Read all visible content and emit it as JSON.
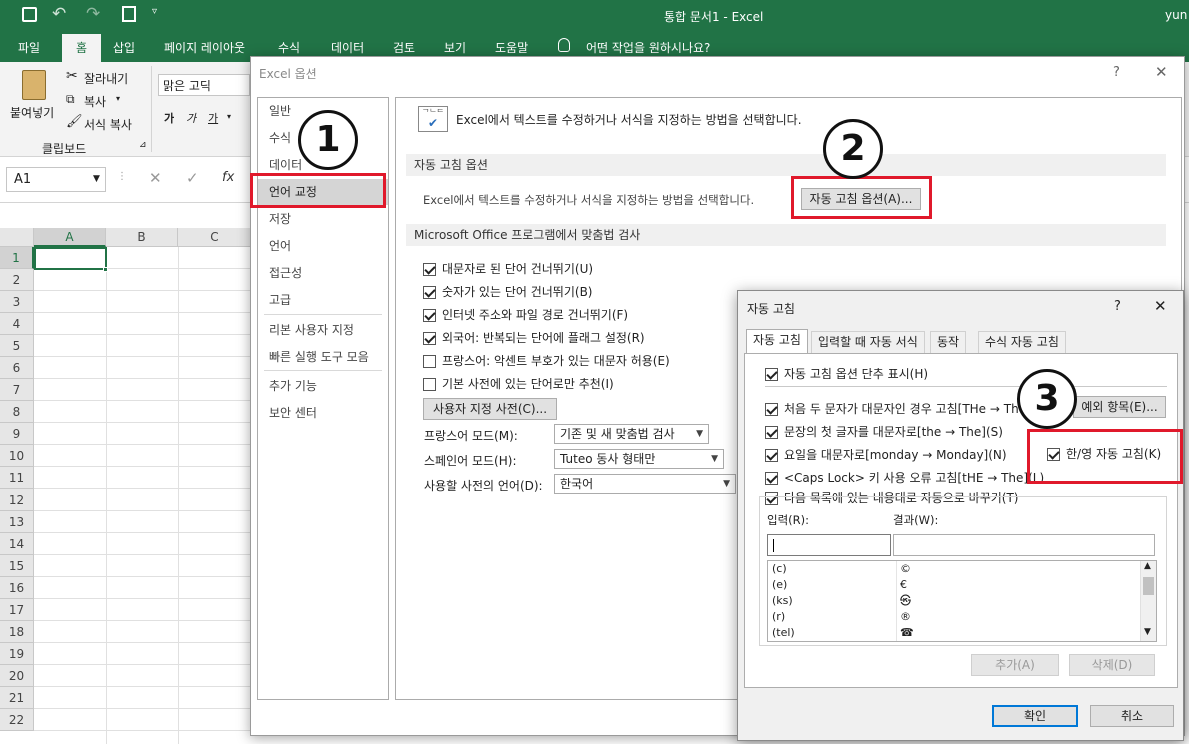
{
  "app": {
    "title": "통합 문서1  -  Excel",
    "user": "yun"
  },
  "ribbon_tabs": [
    "파일",
    "홈",
    "삽입",
    "페이지 레이아웃",
    "수식",
    "데이터",
    "검토",
    "보기",
    "도움말"
  ],
  "tell_me": "어떤 작업을 원하시나요?",
  "clipboard": {
    "paste": "붙여넣기",
    "cut": "잘라내기",
    "copy": "복사",
    "format_painter": "서식 복사",
    "group_label": "클립보드"
  },
  "font": {
    "name": "맑은 고딕",
    "bold": "가",
    "italic": "가",
    "underline": "가"
  },
  "formula_bar": {
    "name_box": "A1",
    "fx": "fx"
  },
  "grid": {
    "columns": [
      "A",
      "B",
      "C"
    ],
    "rows": [
      "1",
      "2",
      "3",
      "4",
      "5",
      "6",
      "7",
      "8",
      "9",
      "10",
      "11",
      "12",
      "13",
      "14",
      "15",
      "16",
      "17",
      "18",
      "19",
      "20",
      "21",
      "22"
    ]
  },
  "options_dialog": {
    "title": "Excel 옵션",
    "help": "?",
    "close": "✕",
    "nav_items": [
      "일반",
      "수식",
      "데이터",
      "언어 교정",
      "저장",
      "언어",
      "접근성",
      "고급",
      "리본 사용자 지정",
      "빠른 실행 도구 모음",
      "추가 기능",
      "보안 센터"
    ],
    "header_text": "Excel에서 텍스트를 수정하거나 서식을 지정하는 방법을 선택합니다.",
    "section1": "자동 고침 옵션",
    "section1_desc": "Excel에서 텍스트를 수정하거나 서식을 지정하는 방법을 선택합니다.",
    "autocorrect_button": "자동 고침 옵션(A)...",
    "section2": "Microsoft Office 프로그램에서 맞춤법 검사",
    "checks": [
      {
        "label": "대문자로 된 단어 건너뛰기(U)",
        "checked": true
      },
      {
        "label": "숫자가 있는 단어 건너뛰기(B)",
        "checked": true
      },
      {
        "label": "인터넷 주소와 파일 경로 건너뛰기(F)",
        "checked": true
      },
      {
        "label": "외국어: 반복되는 단어에 플래그 설정(R)",
        "checked": true
      },
      {
        "label": "프랑스어: 악센트 부호가 있는 대문자 허용(E)",
        "checked": false
      },
      {
        "label": "기본 사전에 있는 단어로만 추천(I)",
        "checked": false
      }
    ],
    "custom_dict_button": "사용자 지정 사전(C)...",
    "modes": [
      {
        "label": "프랑스어 모드(M):",
        "value": "기존 및 새 맞춤법 검사"
      },
      {
        "label": "스페인어 모드(H):",
        "value": "Tuteo 동사 형태만"
      },
      {
        "label": "사용할 사전의 언어(D):",
        "value": "한국어"
      }
    ]
  },
  "autocorrect_dialog": {
    "title": "자동 고침",
    "help": "?",
    "close": "✕",
    "tabs": [
      "자동 고침",
      "입력할 때 자동 서식",
      "동작",
      "수식 자동 고침"
    ],
    "show_buttons": "자동 고침 옵션 단추 표시(H)",
    "options": [
      "처음 두 문자가 대문자인 경우 고침[THe → The](O)",
      "문장의 첫 글자를 대문자로[the → The](S)",
      "요일을 대문자로[monday → Monday](N)",
      "<Caps Lock> 키 사용 오류 고침[tHE → The](L)"
    ],
    "exceptions_button": "예외 항목(E)...",
    "hanyoung": "한/영 자동 고침(K)",
    "replace_text": "다음 목록에 있는 내용대로 자동으로 바꾸기(T)",
    "input_label": "입력(R):",
    "result_label": "결과(W):",
    "list": [
      {
        "in": "(c)",
        "out": "©"
      },
      {
        "in": "(e)",
        "out": "€"
      },
      {
        "in": "(ks)",
        "out": "㉿"
      },
      {
        "in": "(r)",
        "out": "®"
      },
      {
        "in": "(tel)",
        "out": "☎"
      }
    ],
    "add_button": "추가(A)",
    "delete_button": "삭제(D)",
    "ok_button": "확인",
    "cancel_button": "취소"
  },
  "annotations": [
    "1",
    "2",
    "3"
  ],
  "colors": {
    "excel_green": "#217346",
    "highlight_red": "#e0192b"
  }
}
